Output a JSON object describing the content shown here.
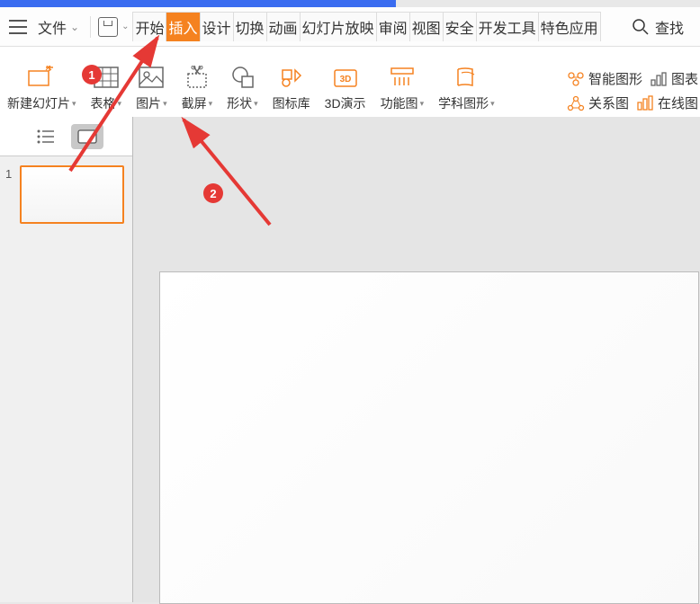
{
  "menu": {
    "file": "文件",
    "tabs": [
      "开始",
      "插入",
      "设计",
      "切换",
      "动画",
      "幻灯片放映",
      "审阅",
      "视图",
      "安全",
      "开发工具",
      "特色应用"
    ],
    "active_tab_index": 1,
    "search": "查找"
  },
  "ribbon": {
    "items": [
      {
        "label": "新建幻灯片",
        "drop": true,
        "icon": "new-slide"
      },
      {
        "label": "表格",
        "drop": true,
        "icon": "table"
      },
      {
        "label": "图片",
        "drop": true,
        "icon": "picture"
      },
      {
        "label": "截屏",
        "drop": true,
        "icon": "screenshot"
      },
      {
        "label": "形状",
        "drop": true,
        "icon": "shapes"
      },
      {
        "label": "图标库",
        "drop": false,
        "icon": "icon-lib"
      },
      {
        "label": "3D演示",
        "drop": false,
        "icon": "3d"
      },
      {
        "label": "功能图",
        "drop": true,
        "icon": "function"
      },
      {
        "label": "学科图形",
        "drop": true,
        "icon": "subject"
      }
    ],
    "right": {
      "smart_graphic": "智能图形",
      "chart": "图表",
      "relation": "关系图",
      "online": "在线图"
    }
  },
  "sidebar": {
    "slides": [
      {
        "num": "1"
      }
    ]
  },
  "annotations": {
    "badge1": "1",
    "badge2": "2"
  }
}
